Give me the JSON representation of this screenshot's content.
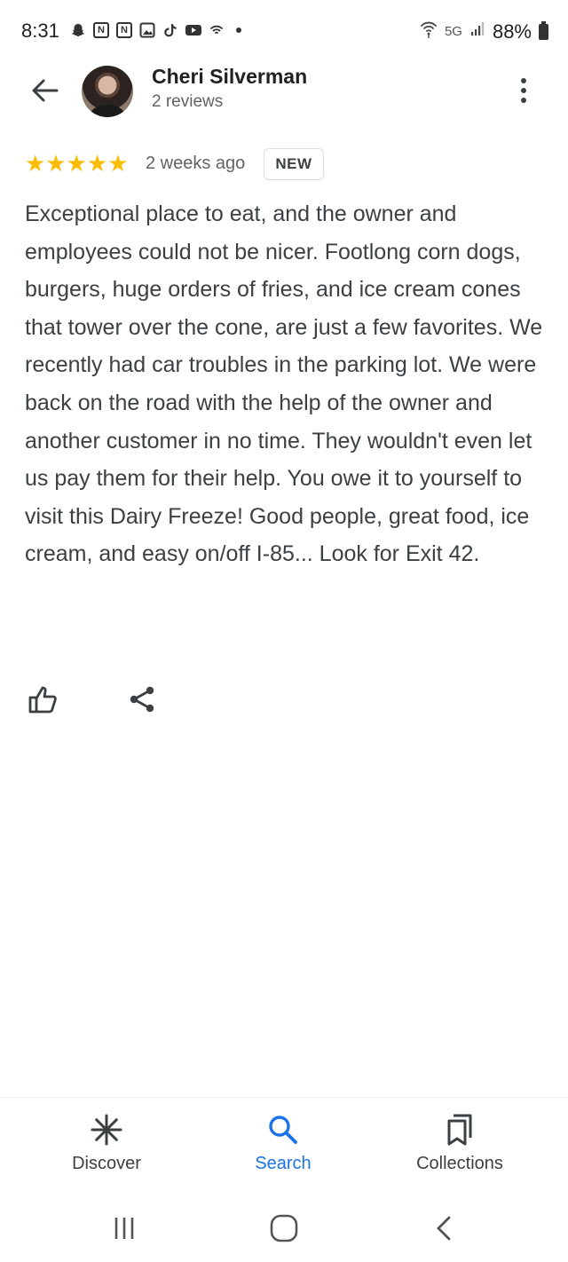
{
  "status_bar": {
    "time": "8:31",
    "network": "5G",
    "battery": "88%",
    "notification_icons": [
      "snapchat-icon",
      "news-icon",
      "news-icon",
      "photo-icon",
      "tiktok-icon",
      "youtube-icon",
      "wifi-call-icon"
    ]
  },
  "header": {
    "user_name": "Cheri Silverman",
    "review_count": "2 reviews"
  },
  "review": {
    "rating": 5,
    "stars": [
      "★",
      "★",
      "★",
      "★",
      "★"
    ],
    "time": "2 weeks ago",
    "badge": "NEW",
    "text": "Exceptional place to eat, and the owner and employees could not be nicer. Footlong corn dogs, burgers, huge orders of fries, and ice cream cones that tower over the cone, are just a few favorites. We recently had car troubles in the parking lot. We were back on the road with the help of the owner and another customer in no time. They wouldn't even let us pay them for their help. You owe it to yourself to visit this Dairy Freeze! Good people, great food, ice cream, and easy on/off I-85... Look for Exit 42."
  },
  "bottom_nav": {
    "items": [
      {
        "label": "Discover",
        "icon": "discover-icon",
        "active": false
      },
      {
        "label": "Search",
        "icon": "search-icon",
        "active": true
      },
      {
        "label": "Collections",
        "icon": "collections-icon",
        "active": false
      }
    ]
  },
  "colors": {
    "star": "#fbbc04",
    "accent": "#1a73e8",
    "text": "#3c4043"
  }
}
